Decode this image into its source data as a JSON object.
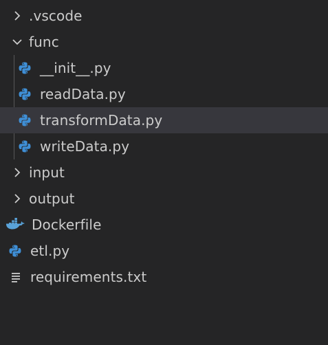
{
  "tree": {
    "items": [
      {
        "label": ".vscode",
        "kind": "folder",
        "expanded": false,
        "depth": 0
      },
      {
        "label": "func",
        "kind": "folder",
        "expanded": true,
        "depth": 0
      },
      {
        "label": "__init__.py",
        "kind": "python",
        "depth": 1
      },
      {
        "label": "readData.py",
        "kind": "python",
        "depth": 1
      },
      {
        "label": "transformData.py",
        "kind": "python",
        "depth": 1,
        "selected": true
      },
      {
        "label": "writeData.py",
        "kind": "python",
        "depth": 1
      },
      {
        "label": "input",
        "kind": "folder",
        "expanded": false,
        "depth": 0
      },
      {
        "label": "output",
        "kind": "folder",
        "expanded": false,
        "depth": 0
      },
      {
        "label": "Dockerfile",
        "kind": "docker",
        "depth": 0
      },
      {
        "label": "etl.py",
        "kind": "python",
        "depth": 0
      },
      {
        "label": "requirements.txt",
        "kind": "text",
        "depth": 0
      }
    ]
  },
  "icons": {
    "folder_collapsed": "chevron-right-icon",
    "folder_expanded": "chevron-down-icon",
    "python": "python-icon",
    "docker": "docker-icon",
    "text": "text-file-icon"
  },
  "colors": {
    "background": "#252526",
    "selected_row": "#37373d",
    "text": "#cccccc",
    "python_blue": "#3f8fd6",
    "python_yellow": "#ffd43b",
    "docker_blue": "#5aa3d9"
  }
}
